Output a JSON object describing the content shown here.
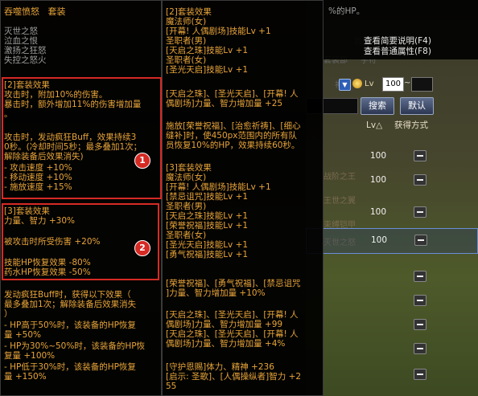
{
  "background_ui": {
    "lv_label": "Lv",
    "lv_min": "100",
    "tilde": "~",
    "search_button": "搜索",
    "default_button": "默认",
    "column_lv": "Lv△",
    "column_acquire": "获得方式",
    "dim_texts": [
      "首称",
      "(X)",
      "套装部",
      "宇符",
      "神话",
      "战阶之王",
      "王世之翼",
      "束缚铠甲",
      "灭世之怒"
    ],
    "rows": [
      {
        "lv": "100"
      },
      {
        "lv": "100"
      },
      {
        "lv": "100"
      },
      {
        "lv": "100"
      },
      {
        "lv": ""
      },
      {
        "lv": ""
      },
      {
        "lv": ""
      },
      {
        "lv": ""
      },
      {
        "lv": ""
      }
    ]
  },
  "top_right": {
    "hp_line": "%的HP。",
    "menu_1": "查看简要说明(F4)",
    "menu_2": "查看普通属性(F8)"
  },
  "left": {
    "title": "吞噬愤怒   套装",
    "items": [
      "灭世之怒",
      "泣血之恨",
      "激扬之狂怒",
      "失控之怒火"
    ],
    "set2_header": "[2]套装效果",
    "set2_lines": [
      "攻击时，附加10%的伤害。",
      "暴击时，额外增加11%的伤害增加量",
      "。"
    ],
    "set2_buff": [
      "攻击时，发动疯狂Buff，效果持续3",
      "0秒。(冷却时间5秒；最多叠加1次；",
      "解除装备后效果消失)",
      "- 攻击速度 +10%",
      "- 移动速度 +10%",
      "- 施放速度 +15%"
    ],
    "set3_header": "[3]套装效果",
    "set3_lines": [
      "力量、智力 +30%",
      "",
      "被攻击时所受伤害 +20%",
      "",
      "技能HP恢复效果 -80%",
      "药水HP恢复效果 -50%"
    ],
    "set3_extra": [
      "发动疯狂Buff时，获得以下效果（",
      "最多叠加1次；解除装备后效果消失",
      "）",
      "- HP高于50%时，该装备的HP恢复",
      "量 +50%",
      "- HP为30%~50%时，该装备的HP恢",
      "复量 +100%",
      "- HP低于30%时，该装备的HP恢复",
      "量 +150%"
    ],
    "badge_1": "1",
    "badge_2": "2"
  },
  "middle": {
    "set2_header": "[2]套装效果",
    "mage_f": "魔法师(女)",
    "block1": [
      "[开幕! 人偶剧场]技能Lv +1",
      "圣职者(男)",
      "[天启之珠]技能Lv +1",
      "圣职者(女)",
      "[圣光天启]技能Lv +1"
    ],
    "block2": [
      "[天启之珠]、[圣光天启]、[开幕! 人",
      "偶剧场]力量、智力增加量 +25"
    ],
    "block3": [
      "施放[荣誉祝福]、[治愈祈祷]、[细心",
      "缝补]时，使450px范围内的所有队",
      "员恢复10%的HP，效果持续60秒。"
    ],
    "set3_header": "[3]套装效果",
    "block4": [
      "魔法师(女)",
      "[开幕! 人偶剧场]技能Lv +1",
      "[禁忌诅咒]技能Lv +1",
      "圣职者(男)",
      "[天启之珠]技能Lv +1",
      "[荣誉祝福]技能Lv +1",
      "圣职者(女)",
      "[圣光天启]技能Lv +1",
      "[勇气祝福]技能Lv +1"
    ],
    "block5": [
      "[荣誉祝福]、[勇气祝福]、[禁忌诅咒",
      "]力量、智力增加量 +10%"
    ],
    "block6": [
      "[天启之珠]、[圣光天启]、[开幕! 人",
      "偶剧场]力量、智力增加量 +99",
      "[天启之珠]、[圣光天启]、[开幕! 人",
      "偶剧场]力量、智力增加量 +4%"
    ],
    "block7": [
      "[守护恩赐]体力、精神 +236",
      "[启示: 圣歌]、[人偶操纵者]智力 +2",
      "55"
    ]
  },
  "colors": {
    "title": "#e8a43a",
    "item": "#9e9e9e",
    "effect": "#e8e8e8",
    "highlight": "#d62a24"
  }
}
